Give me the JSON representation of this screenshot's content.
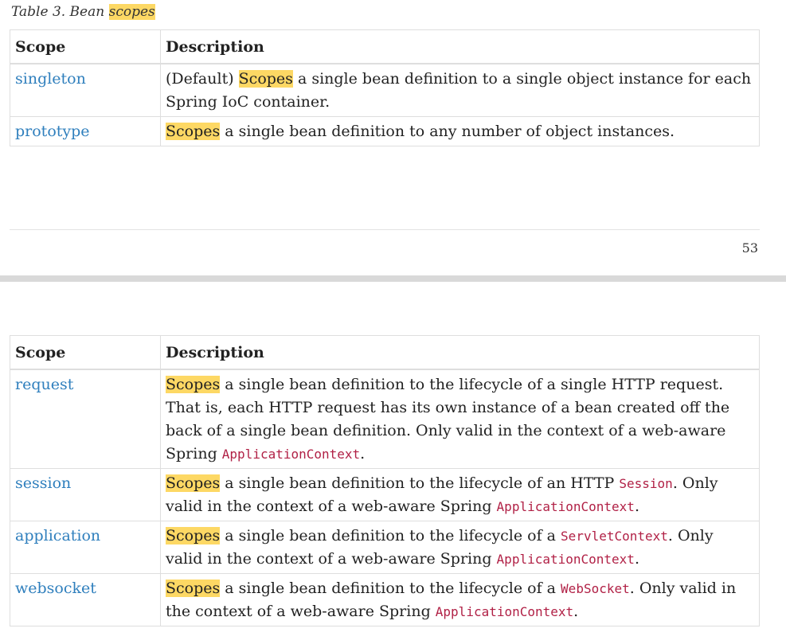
{
  "caption": {
    "prefix": "Table 3. Bean ",
    "highlight": "scopes"
  },
  "table1": {
    "headers": [
      "Scope",
      "Description"
    ],
    "rows": [
      {
        "scope": "singleton",
        "desc": [
          {
            "t": "(Default) "
          },
          {
            "t": "Scopes",
            "h": true
          },
          {
            "t": " a single bean definition to a single object instance for each Spring IoC container."
          }
        ]
      },
      {
        "scope": "prototype",
        "desc": [
          {
            "t": "Scopes",
            "h": true
          },
          {
            "t": " a single bean definition to any number of object instances."
          }
        ]
      }
    ]
  },
  "page_number": "53",
  "table2": {
    "headers": [
      "Scope",
      "Description"
    ],
    "rows": [
      {
        "scope": "request",
        "desc": [
          {
            "t": "Scopes",
            "h": true
          },
          {
            "t": " a single bean definition to the lifecycle of a single HTTP request. That is, each HTTP request has its own instance of a bean created off the back of a single bean definition. Only valid in the context of a web-aware Spring "
          },
          {
            "t": "ApplicationContext",
            "c": true
          },
          {
            "t": "."
          }
        ]
      },
      {
        "scope": "session",
        "desc": [
          {
            "t": "Scopes",
            "h": true
          },
          {
            "t": " a single bean definition to the lifecycle of an HTTP "
          },
          {
            "t": "Session",
            "c": true
          },
          {
            "t": ". Only valid in the context of a web-aware Spring "
          },
          {
            "t": "ApplicationContext",
            "c": true
          },
          {
            "t": "."
          }
        ]
      },
      {
        "scope": "application",
        "desc": [
          {
            "t": "Scopes",
            "h": true
          },
          {
            "t": " a single bean definition to the lifecycle of a "
          },
          {
            "t": "ServletContext",
            "c": true
          },
          {
            "t": ". Only valid in the context of a web-aware Spring "
          },
          {
            "t": "ApplicationContext",
            "c": true
          },
          {
            "t": "."
          }
        ]
      },
      {
        "scope": "websocket",
        "desc": [
          {
            "t": "Scopes",
            "h": true
          },
          {
            "t": " a single bean definition to the lifecycle of a "
          },
          {
            "t": "WebSocket",
            "c": true
          },
          {
            "t": ". Only valid in the context of a web-aware Spring "
          },
          {
            "t": "ApplicationContext",
            "c": true
          },
          {
            "t": "."
          }
        ]
      }
    ]
  }
}
